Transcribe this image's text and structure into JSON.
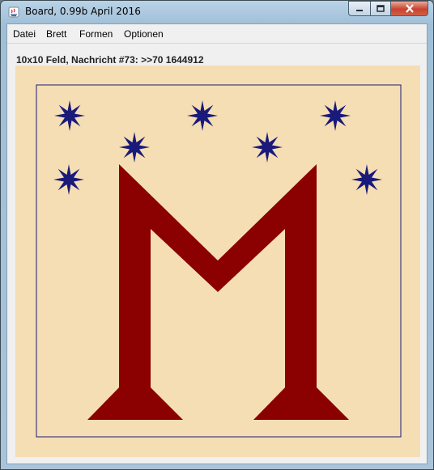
{
  "window": {
    "title": "Board, 0.99b April 2016"
  },
  "menu": {
    "items": [
      "Datei",
      "Brett",
      "Formen",
      "Optionen"
    ]
  },
  "status": {
    "text": "10x10 Feld, Nachricht #73: >>70 1644912"
  },
  "board": {
    "background_color": "#f5deb3",
    "frame_color": "#1a1a7a",
    "star_color": "#1a1a7a",
    "letter_color": "#8b0000",
    "stars_count": 7
  }
}
